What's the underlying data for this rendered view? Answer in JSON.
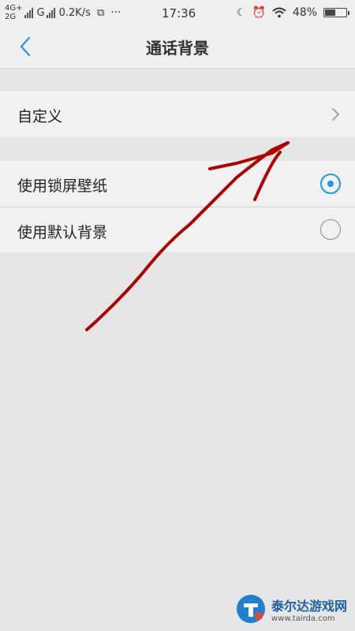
{
  "status_bar": {
    "network_top": "4G+",
    "network_bottom": "2G",
    "carrier": "G",
    "speed": "0.2K/s",
    "time": "17:36",
    "battery": "48%",
    "battery_level": 0.48
  },
  "header": {
    "title": "通话背景"
  },
  "options": {
    "custom_label": "自定义",
    "lockscreen_label": "使用锁屏壁纸",
    "lockscreen_selected": true,
    "default_label": "使用默认背景",
    "default_selected": false
  },
  "colors": {
    "accent": "#1a9be6",
    "annotation": "#b00000"
  },
  "watermark": {
    "brand": "泰尔达游戏网",
    "url": "www.tairda.com"
  }
}
